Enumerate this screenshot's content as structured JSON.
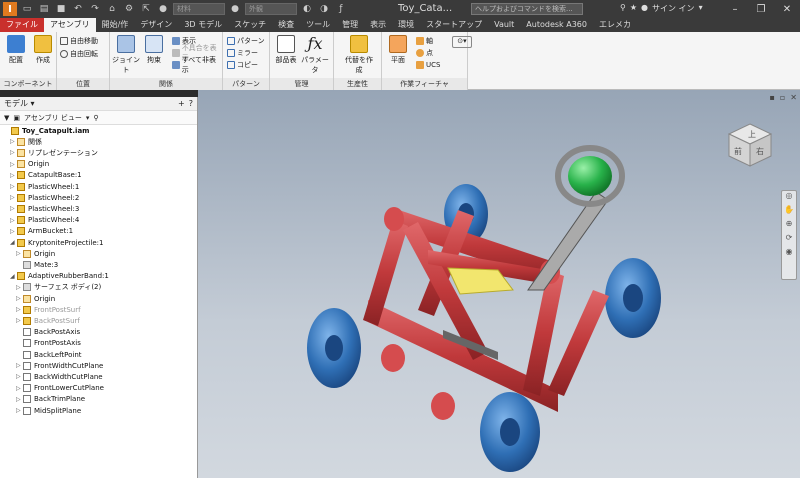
{
  "app": {
    "doc_title": "Toy_Cata...",
    "help_placeholder": "ヘルプおよびコマンドを検索...",
    "signin": "サイン イン",
    "material_combo": "材料",
    "appearance_combo": "外観"
  },
  "tabs": [
    "ファイル",
    "アセンブリ",
    "開始/作",
    "デザイン",
    "3D モデル",
    "スケッチ",
    "検査",
    "ツール",
    "管理",
    "表示",
    "環境",
    "スタートアップ",
    "Vault",
    "Autodesk A360",
    "エレメカ"
  ],
  "active_tab": 1,
  "ribbon": {
    "component": {
      "label": "コンポーネント",
      "place": "配置",
      "create": "作成"
    },
    "position": {
      "label": "位置",
      "free_move": "自由移動",
      "free_rotate": "自由回転"
    },
    "relation": {
      "label": "関係",
      "joint": "ジョイント",
      "constrain": "拘束",
      "show": "表示",
      "hide_problem": "不具合を表示",
      "hide_all": "すべて非表示"
    },
    "pattern": {
      "label": "パターン",
      "pattern": "パターン",
      "mirror": "ミラー",
      "copy": "コピー"
    },
    "manage": {
      "label": "管理",
      "bom": "部品表",
      "params": "パラメータ"
    },
    "productivity": {
      "label": "生産性",
      "substitute": "代替を作成"
    },
    "workfeatures": {
      "label": "作業フィーチャ",
      "plane": "平面",
      "axis": "軸",
      "point": "点",
      "ucs": "UCS"
    }
  },
  "browser": {
    "header": "モデル",
    "view": "アセンブリ ビュー",
    "items": [
      {
        "label": "Toy_Catapult.iam",
        "level": 0,
        "icon": "assembly",
        "style": "bold",
        "expander": ""
      },
      {
        "label": "関係",
        "level": 1,
        "icon": "folder",
        "style": "",
        "expander": "▷"
      },
      {
        "label": "リプレゼンテーション",
        "level": 1,
        "icon": "folder",
        "style": "",
        "expander": "▷"
      },
      {
        "label": "Origin",
        "level": 1,
        "icon": "folder",
        "style": "",
        "expander": "▷"
      },
      {
        "label": "CatapultBase:1",
        "level": 1,
        "icon": "part",
        "style": "",
        "expander": "▷"
      },
      {
        "label": "PlasticWheel:1",
        "level": 1,
        "icon": "part",
        "style": "",
        "expander": "▷"
      },
      {
        "label": "PlasticWheel:2",
        "level": 1,
        "icon": "part",
        "style": "",
        "expander": "▷"
      },
      {
        "label": "PlasticWheel:3",
        "level": 1,
        "icon": "part",
        "style": "",
        "expander": "▷"
      },
      {
        "label": "PlasticWheel:4",
        "level": 1,
        "icon": "part",
        "style": "",
        "expander": "▷"
      },
      {
        "label": "ArmBucket:1",
        "level": 1,
        "icon": "part",
        "style": "",
        "expander": "▷"
      },
      {
        "label": "KryptonitеProjectile:1",
        "level": 1,
        "icon": "part",
        "style": "",
        "expander": "◢"
      },
      {
        "label": "Origin",
        "level": 2,
        "icon": "folder",
        "style": "",
        "expander": "▷"
      },
      {
        "label": "Mate:3",
        "level": 2,
        "icon": "surf",
        "style": "",
        "expander": ""
      },
      {
        "label": "AdaptiveRubberBand:1",
        "level": 1,
        "icon": "part",
        "style": "",
        "expander": "◢"
      },
      {
        "label": "サーフェス ボディ(2)",
        "level": 2,
        "icon": "surf",
        "style": "",
        "expander": "▷"
      },
      {
        "label": "Origin",
        "level": 2,
        "icon": "folder",
        "style": "",
        "expander": "▷"
      },
      {
        "label": "FrontPostSurf",
        "level": 2,
        "icon": "part",
        "style": "grey",
        "expander": "▷"
      },
      {
        "label": "BackPostSurf",
        "level": 2,
        "icon": "part",
        "style": "grey",
        "expander": "▷"
      },
      {
        "label": "BackPostAxis",
        "level": 2,
        "icon": "axis",
        "style": "",
        "expander": ""
      },
      {
        "label": "FrontPostAxis",
        "level": 2,
        "icon": "axis",
        "style": "",
        "expander": ""
      },
      {
        "label": "BackLeftPoint",
        "level": 2,
        "icon": "axis",
        "style": "",
        "expander": ""
      },
      {
        "label": "FrontWidthCutPlane",
        "level": 2,
        "icon": "plane",
        "style": "",
        "expander": "▷"
      },
      {
        "label": "BackWidthCutPlane",
        "level": 2,
        "icon": "plane",
        "style": "",
        "expander": "▷"
      },
      {
        "label": "FrontLowerCutPlane",
        "level": 2,
        "icon": "plane",
        "style": "",
        "expander": "▷"
      },
      {
        "label": "BackTrimPlane",
        "level": 2,
        "icon": "plane",
        "style": "",
        "expander": "▷"
      },
      {
        "label": "MidSplitPlane",
        "level": 2,
        "icon": "plane",
        "style": "",
        "expander": "▷"
      }
    ]
  },
  "viewcube": {
    "top": "上",
    "front": "前",
    "right": "右"
  },
  "colors": {
    "frame": "#c0393b",
    "wheel": "#2f6fb5",
    "ball": "#28b24a",
    "band": "#f2e66e",
    "accent": "#c9302c"
  }
}
